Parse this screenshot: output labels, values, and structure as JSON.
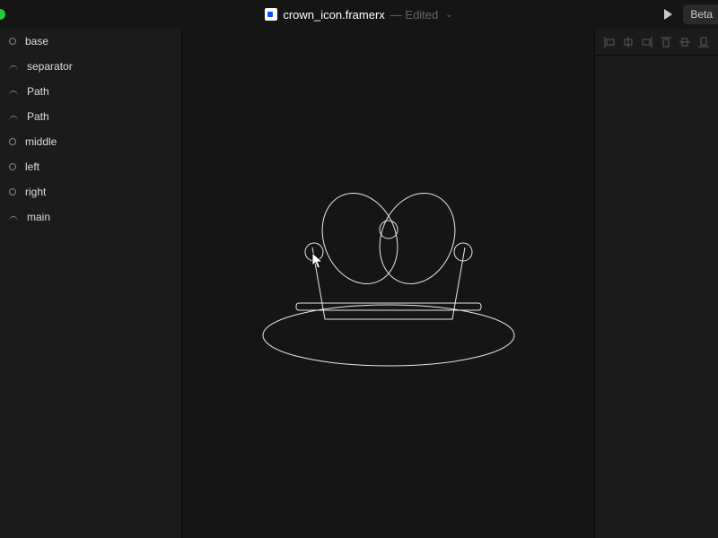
{
  "titlebar": {
    "filename": "crown_icon.framerx",
    "status": "— Edited",
    "beta_label": "Beta"
  },
  "layers": [
    {
      "name": "base",
      "icon": "circle"
    },
    {
      "name": "separator",
      "icon": "path"
    },
    {
      "name": "Path",
      "icon": "path"
    },
    {
      "name": "Path",
      "icon": "path"
    },
    {
      "name": "middle",
      "icon": "circle"
    },
    {
      "name": "left",
      "icon": "circle"
    },
    {
      "name": "right",
      "icon": "circle"
    },
    {
      "name": "main",
      "icon": "path"
    }
  ],
  "align_tools": [
    "align-left",
    "align-center-h",
    "align-right",
    "align-top",
    "align-center-v",
    "align-bottom"
  ]
}
